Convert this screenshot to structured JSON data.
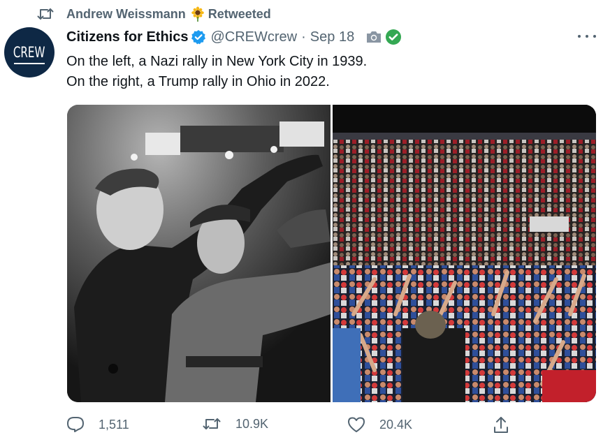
{
  "retweet_banner": {
    "user": "Andrew Weissmann",
    "emoji": "sunflower",
    "label": "Retweeted"
  },
  "author": {
    "avatar_text": "CREW",
    "display_name": "Citizens for Ethics",
    "handle": "@CREWcrew",
    "separator": "·",
    "date": "Sep 18"
  },
  "tweet": {
    "lines": [
      "On the left, a Nazi rally in New York City in 1939.",
      "On the right, a Trump rally in Ohio in 2022."
    ]
  },
  "actions": {
    "reply_count": "1,511",
    "retweet_count": "10.9K",
    "like_count": "20.4K"
  },
  "icons": {
    "retweet": "retweet-icon",
    "verified": "verified-badge-icon",
    "camera": "camera-icon",
    "check": "check-circle-icon",
    "more": "more-icon",
    "reply": "reply-icon",
    "like": "heart-icon",
    "share": "share-icon"
  },
  "colors": {
    "secondary_text": "#536471",
    "verified": "#1d9bf0",
    "check": "#34a853",
    "avatar_bg": "#0e2845"
  }
}
